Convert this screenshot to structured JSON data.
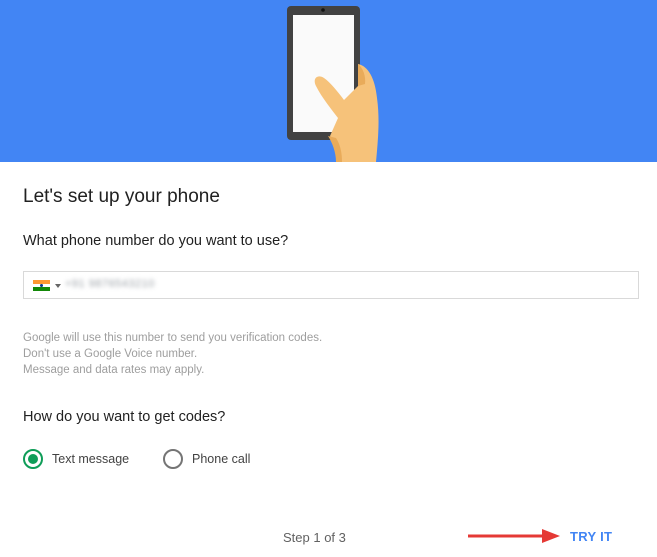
{
  "hero": {
    "background_color": "#4285f4",
    "illustration_icon": "hand-holding-phone-illustration"
  },
  "title": "Let's set up your phone",
  "phone_question": "What phone number do you want to use?",
  "phone_field": {
    "country_flag_icon": "india-flag-icon",
    "value": "+91 9876543210",
    "value_obscured": true
  },
  "notes": [
    "Google will use this number to send you verification codes.",
    "Don't use a Google Voice number.",
    "Message and data rates may apply."
  ],
  "codes_question": "How do you want to get codes?",
  "delivery_options": [
    {
      "label": "Text message",
      "selected": true
    },
    {
      "label": "Phone call",
      "selected": false
    }
  ],
  "footer": {
    "step_text": "Step 1 of 3",
    "try_it_label": "TRY IT",
    "accent_color": "#4285f4",
    "annotation_arrow_color": "#e53935"
  }
}
